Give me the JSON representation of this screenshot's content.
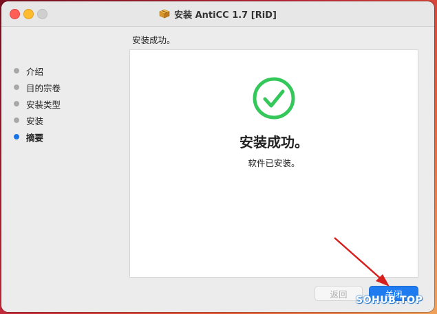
{
  "window": {
    "title": "安装 AntiCC 1.7 [RiD]",
    "icons": {
      "close": "red-dot",
      "minimize": "yellow-dot",
      "zoom": "gray-dot",
      "app": "package-icon"
    }
  },
  "sidebar": {
    "items": [
      {
        "label": "介绍",
        "active": false
      },
      {
        "label": "目的宗卷",
        "active": false
      },
      {
        "label": "安装类型",
        "active": false
      },
      {
        "label": "安装",
        "active": false
      },
      {
        "label": "摘要",
        "active": true
      }
    ]
  },
  "main": {
    "header": "安装成功。",
    "status_title": "安装成功。",
    "status_message": "软件已安装。",
    "status_icon": "checkmark-circle-icon",
    "status_color": "#34c759"
  },
  "buttons": {
    "back_label": "返回",
    "close_label": "关闭",
    "accent_color": "#1f7cf0"
  },
  "overlay": {
    "watermark": "SOHUB.TOP",
    "arrow_color": "#d62020"
  }
}
